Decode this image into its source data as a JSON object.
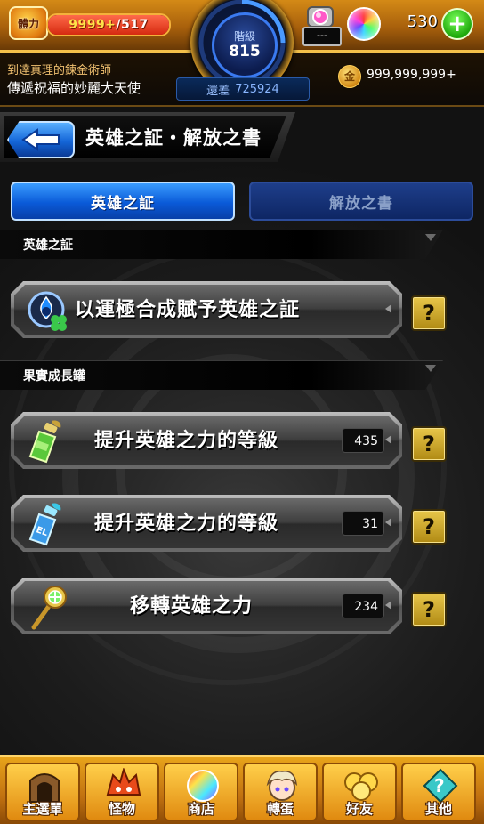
{
  "status_bar": {
    "stamina_label": "體力",
    "stamina_current": "9999+",
    "stamina_max": "/517",
    "rank_label": "階級",
    "rank_value": "815",
    "exp_remaining_label": "還差",
    "exp_remaining_value": "725924",
    "gem_count": "---",
    "orb_count": "530",
    "coin_count": "999,999,999+",
    "title_line1": "到達真理的鍊金術師",
    "title_line2": "傳遞祝福的妙麗大天使"
  },
  "header": {
    "title": "英雄之証・解放之書"
  },
  "tabs": [
    {
      "label": "英雄之証",
      "active": true
    },
    {
      "label": "解放之書",
      "active": false
    }
  ],
  "sections": [
    {
      "title": "英雄之証",
      "items": [
        {
          "label": "以運極合成賦予英雄之証",
          "icon": "clover-flame-icon",
          "help": "?"
        }
      ]
    },
    {
      "title": "果實成長罐",
      "items": [
        {
          "label": "提升英雄之力的等級",
          "icon": "green-bottle-icon",
          "count": "435",
          "help": "?"
        },
        {
          "label": "提升英雄之力的等級",
          "icon": "blue-el-bottle-icon",
          "count": "31",
          "help": "?"
        },
        {
          "label": "移轉英雄之力",
          "icon": "golden-staff-icon",
          "count": "234",
          "help": "?"
        }
      ]
    }
  ],
  "bottom_nav": [
    {
      "label": "主選單",
      "icon": "gate-icon"
    },
    {
      "label": "怪物",
      "icon": "monster-icon"
    },
    {
      "label": "商店",
      "icon": "orb-shop-icon"
    },
    {
      "label": "轉蛋",
      "icon": "gacha-character-icon"
    },
    {
      "label": "好友",
      "icon": "friends-icon"
    },
    {
      "label": "其他",
      "icon": "other-icon"
    }
  ],
  "colors": {
    "accent_orange": "#d48a16",
    "tab_active": "#0a5ad8",
    "tab_inactive": "#1e3e8a",
    "help_gold": "#e8c64a",
    "add_green": "#1ea80c"
  }
}
